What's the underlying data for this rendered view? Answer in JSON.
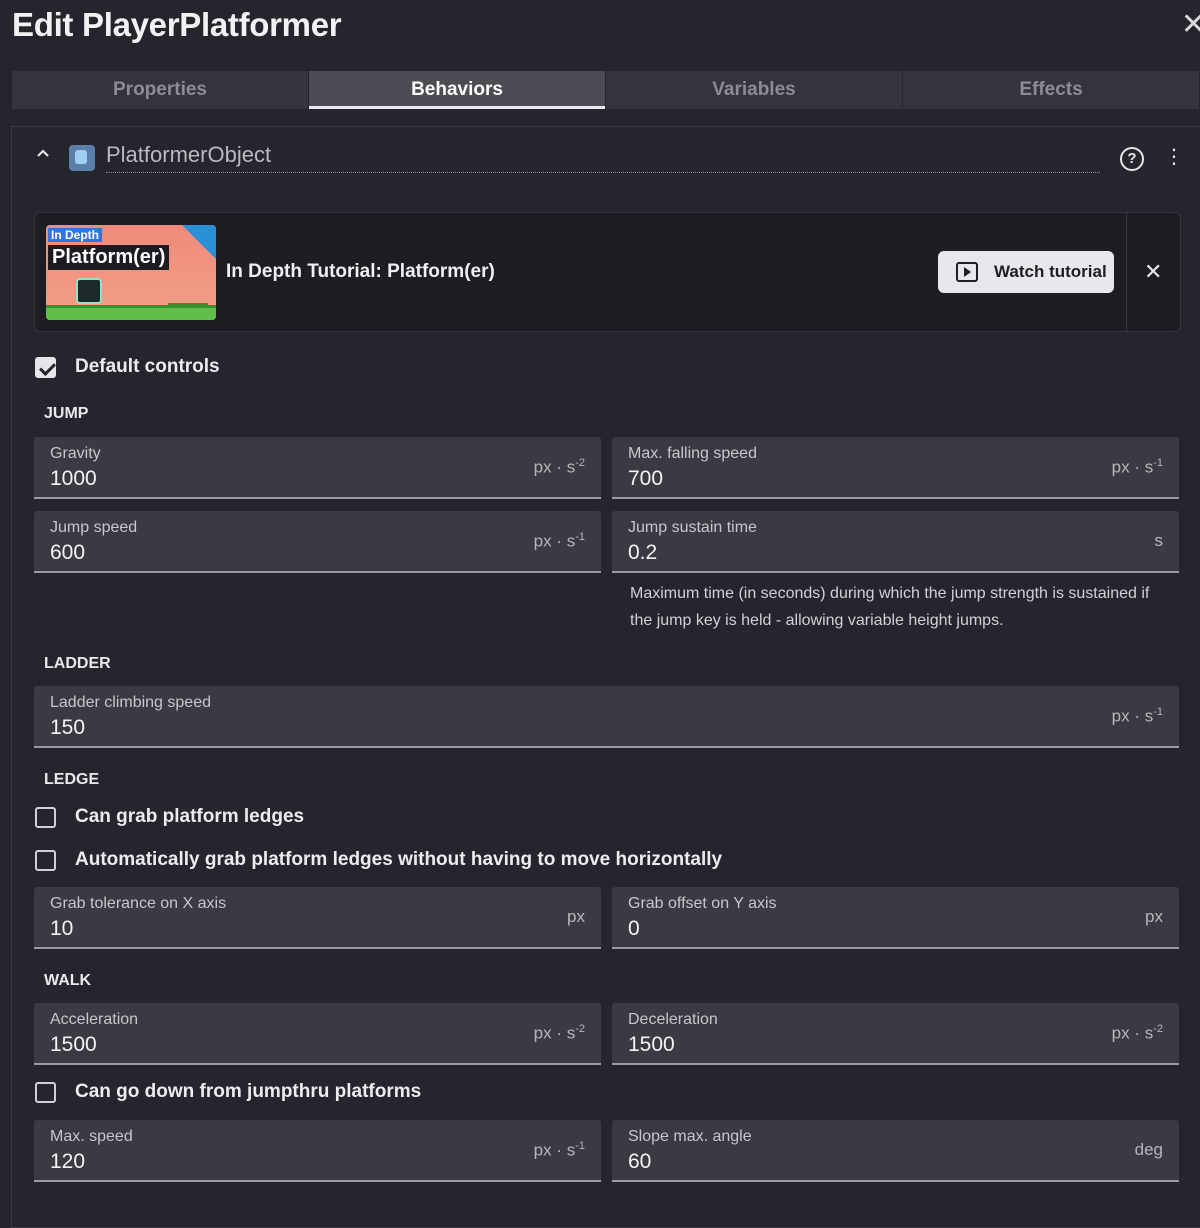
{
  "title": "Edit PlayerPlatformer",
  "tabs": [
    "Properties",
    "Behaviors",
    "Variables",
    "Effects"
  ],
  "behavior": {
    "name": "PlatformerObject"
  },
  "tutorial": {
    "thumb_tag": "In Depth",
    "thumb_title": "Platform(er)",
    "title": "In Depth Tutorial: Platform(er)",
    "watch_label": "Watch tutorial"
  },
  "default_controls": {
    "label": "Default controls",
    "checked": true
  },
  "sections": {
    "jump": "JUMP",
    "ladder": "LADDER",
    "ledge": "LEDGE",
    "walk": "WALK"
  },
  "fields": {
    "gravity": {
      "label": "Gravity",
      "value": "1000",
      "unit": "px · s",
      "exp": "-2"
    },
    "max_falling_speed": {
      "label": "Max. falling speed",
      "value": "700",
      "unit": "px · s",
      "exp": "-1"
    },
    "jump_speed": {
      "label": "Jump speed",
      "value": "600",
      "unit": "px · s",
      "exp": "-1"
    },
    "jump_sustain_time": {
      "label": "Jump sustain time",
      "value": "0.2",
      "unit": "s",
      "helper": "Maximum time (in seconds) during which the jump strength is sustained if the jump key is held - allowing variable height jumps."
    },
    "ladder_climbing_speed": {
      "label": "Ladder climbing speed",
      "value": "150",
      "unit": "px · s",
      "exp": "-1"
    },
    "grab_tolerance_x": {
      "label": "Grab tolerance on X axis",
      "value": "10",
      "unit": "px"
    },
    "grab_offset_y": {
      "label": "Grab offset on Y axis",
      "value": "0",
      "unit": "px"
    },
    "acceleration": {
      "label": "Acceleration",
      "value": "1500",
      "unit": "px · s",
      "exp": "-2"
    },
    "deceleration": {
      "label": "Deceleration",
      "value": "1500",
      "unit": "px · s",
      "exp": "-2"
    },
    "max_speed": {
      "label": "Max. speed",
      "value": "120",
      "unit": "px · s",
      "exp": "-1"
    },
    "slope_max_angle": {
      "label": "Slope max. angle",
      "value": "60",
      "unit": "deg"
    }
  },
  "checkboxes": {
    "can_grab_ledges": {
      "label": "Can grab platform ledges",
      "checked": false
    },
    "auto_grab_ledges": {
      "label": "Automatically grab platform ledges without having to move horizontally",
      "checked": false
    },
    "jumpthru_down": {
      "label": "Can go down from jumpthru platforms",
      "checked": false
    }
  }
}
